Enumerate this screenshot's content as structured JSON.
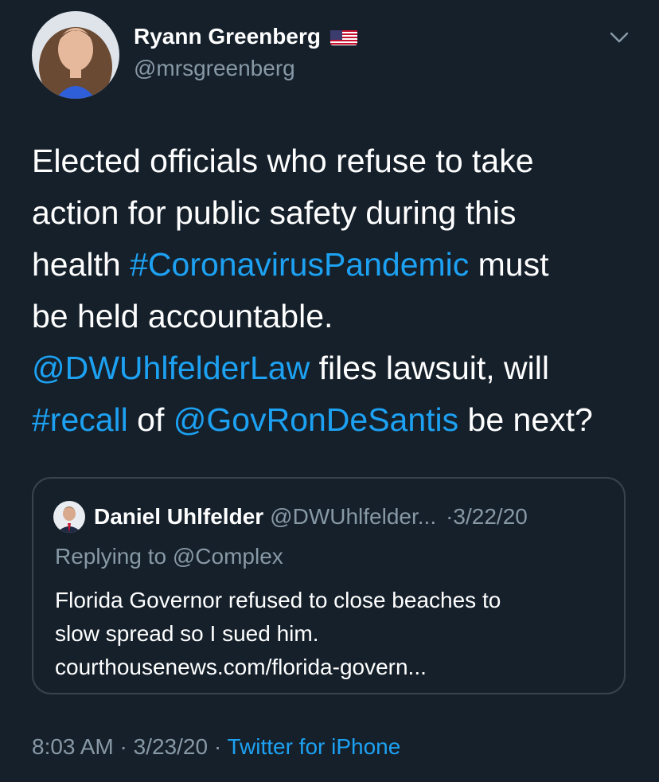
{
  "author": {
    "name": "Ryann Greenberg",
    "handle": "@mrsgreenberg",
    "flag_icon": "us-flag-icon"
  },
  "tweet": {
    "lines": [
      [
        {
          "text": "Elected officials who refuse to take",
          "link": false
        }
      ],
      [
        {
          "text": "action for public safety during this",
          "link": false
        }
      ],
      [
        {
          "text": "health ",
          "link": false
        },
        {
          "text": "#CoronavirusPandemic",
          "link": true
        },
        {
          "text": " must",
          "link": false
        }
      ],
      [
        {
          "text": "be held accountable.",
          "link": false
        }
      ],
      [
        {
          "text": "@DWUhlfelderLaw",
          "link": true
        },
        {
          "text": " files lawsuit, will",
          "link": false
        }
      ],
      [
        {
          "text": "#recall",
          "link": true
        },
        {
          "text": " of ",
          "link": false
        },
        {
          "text": "@GovRonDeSantis",
          "link": true
        },
        {
          "text": " be next?",
          "link": false
        }
      ]
    ]
  },
  "quote": {
    "name": "Daniel Uhlfelder",
    "handle": "@DWUhlfelder...",
    "separator": "·",
    "date": "3/22/20",
    "replying": "Replying to @Complex",
    "body_lines": [
      "Florida Governor refused to close beaches to",
      "slow spread so I sued him.",
      "courthousenews.com/florida-govern..."
    ]
  },
  "meta": {
    "time": "8:03 AM",
    "separator": "·",
    "date": "3/23/20",
    "source": "Twitter for iPhone"
  },
  "colors": {
    "background": "#15202b",
    "text": "#ffffff",
    "secondary": "#8899a6",
    "link": "#1da1f2",
    "border": "#38444d"
  }
}
